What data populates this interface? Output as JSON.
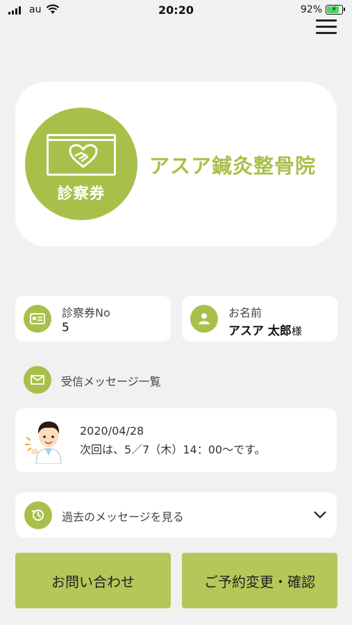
{
  "status_bar": {
    "carrier": "au",
    "time": "20:20",
    "battery": "92%"
  },
  "menu": {
    "icon": "hamburger-menu-icon"
  },
  "hero": {
    "ticket_label": "診察券",
    "clinic_name": "アスア鍼灸整骨院",
    "icon": "handshake-icon"
  },
  "patient": {
    "card_no_label": "診察券No",
    "card_no": "5",
    "name_label": "お名前",
    "name": "アスア 太郎",
    "name_suffix": "様"
  },
  "messages": {
    "header": "受信メッセージ一覧",
    "latest": {
      "date": "2020/04/28",
      "text": "次回は、5／7（木）14：00～です。"
    },
    "past_label": "過去のメッセージを見る"
  },
  "buttons": {
    "contact": "お問い合わせ",
    "reserve": "ご予約変更・確認"
  },
  "colors": {
    "accent": "#a8c04a",
    "button": "#b5c758",
    "background": "#f1f1f1"
  }
}
